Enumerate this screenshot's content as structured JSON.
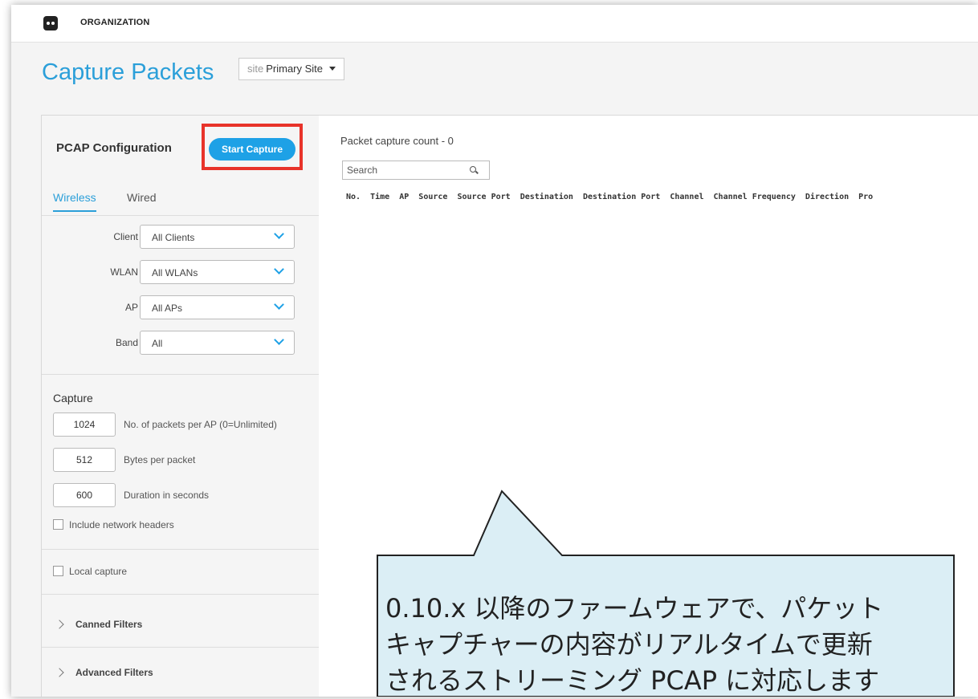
{
  "header": {
    "org_label": "ORGANIZATION"
  },
  "page": {
    "title": "Capture Packets",
    "site_selector": {
      "prefix": "site",
      "value": "Primary Site"
    }
  },
  "config": {
    "title": "PCAP Configuration",
    "start_button": "Start Capture",
    "tabs": [
      {
        "label": "Wireless",
        "active": true
      },
      {
        "label": "Wired",
        "active": false
      }
    ],
    "filters": [
      {
        "label": "Client",
        "value": "All Clients"
      },
      {
        "label": "WLAN",
        "value": "All WLANs"
      },
      {
        "label": "AP",
        "value": "All APs"
      },
      {
        "label": "Band",
        "value": "All"
      }
    ],
    "capture": {
      "title": "Capture",
      "fields": [
        {
          "value": "1024",
          "label": "No. of packets per AP (0=Unlimited)"
        },
        {
          "value": "512",
          "label": "Bytes per packet"
        },
        {
          "value": "600",
          "label": "Duration in seconds"
        }
      ],
      "include_headers": "Include network headers",
      "local_capture": "Local capture"
    },
    "sections": [
      "Canned Filters",
      "Advanced Filters"
    ]
  },
  "results": {
    "count_label": "Packet capture count - 0",
    "search_placeholder": "Search",
    "columns": [
      "No.",
      "Time",
      "AP",
      "Source",
      "Source Port",
      "Destination",
      "Destination Port",
      "Channel",
      "Channel Frequency",
      "Direction",
      "Pro"
    ]
  },
  "callout": {
    "lines": [
      "0.10.x 以降のファームウェアで、パケット",
      "キャプチャーの内容がリアルタイムで更新",
      "されるストリーミング PCAP に対応します"
    ]
  },
  "colors": {
    "accent": "#2b9fd9",
    "button": "#1ea1e6",
    "highlight": "#e8332a",
    "callout_fill": "#dbeef5"
  }
}
